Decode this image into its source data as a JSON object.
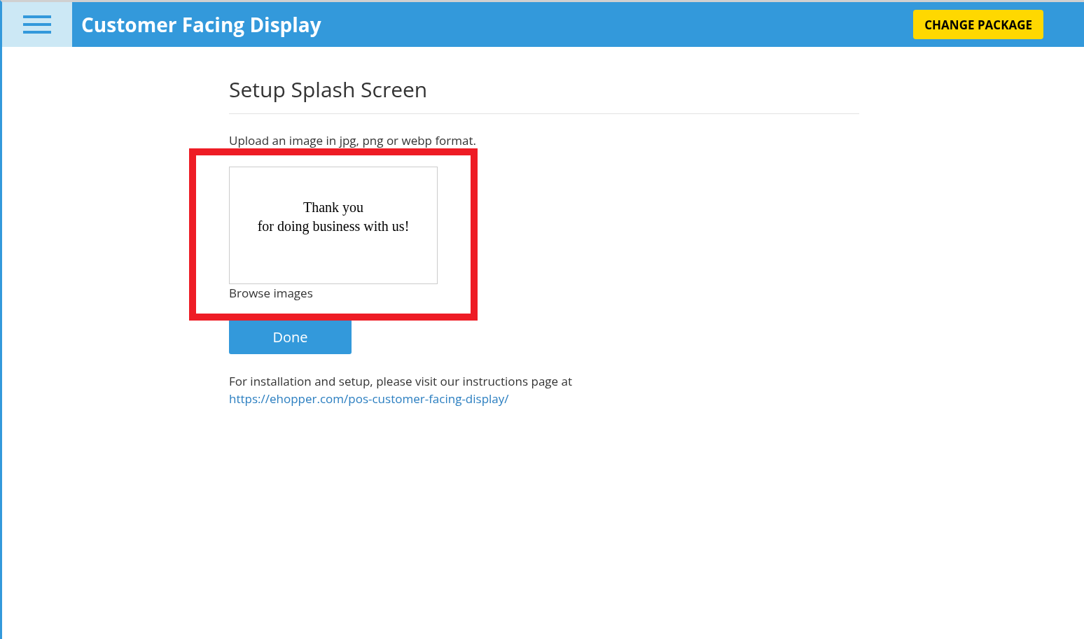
{
  "header": {
    "title": "Customer Facing Display",
    "action": "CHANGE PACKAGE"
  },
  "page": {
    "title": "Setup Splash Screen",
    "hint": "Upload an image in jpg, png or webp format.",
    "preview": {
      "lines": [
        "Thank you",
        "for doing business with us!"
      ]
    },
    "browse": "Browse images",
    "highlighted": true,
    "done": "Done",
    "instructions": "For installation and setup, please visit our instructions page at",
    "link": "https://ehopper.com/pos-customer-facing-display/"
  }
}
